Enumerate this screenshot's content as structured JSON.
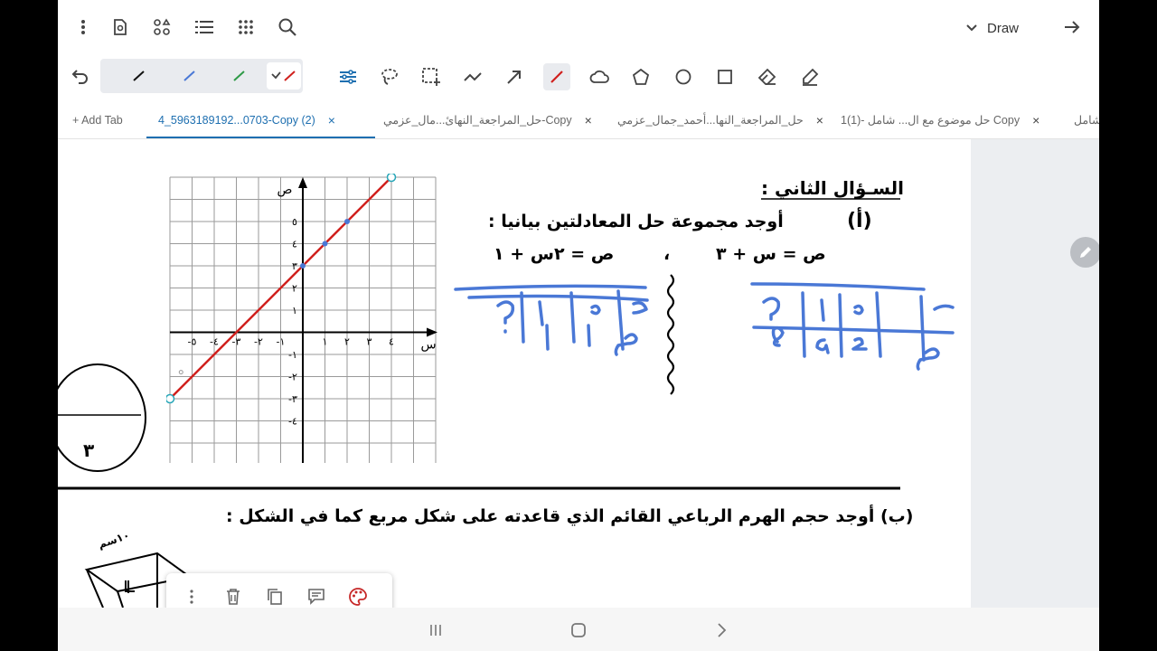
{
  "toolbar": {
    "draw_label": "Draw"
  },
  "tabs": {
    "add_tab": "+ Add Tab",
    "items": [
      {
        "label": "4_5963189192...0703-Copy (2)",
        "close": "×"
      },
      {
        "label": "حل_المراجعة_النهائ...مال_عزمي-Copy",
        "close": "×"
      },
      {
        "label": "حل_المراجعة_النها...أحمد_جمال_عزمي",
        "close": "×"
      },
      {
        "label": "1حل موضوع مع ال... شامل -(1) Copy",
        "close": "×"
      },
      {
        "label": "شامل",
        "close": ""
      }
    ]
  },
  "document": {
    "question_title": "السـؤال الثاني :",
    "part_a_label": "(أ)",
    "part_a_text": "أوجد مجموعة حل المعادلتين بيانيا :",
    "equation_1": "ص = س + ٣",
    "separator": "،",
    "equation_2": "ص = ٢س + ١",
    "part_b_text": "(ب) أوجد حجم الهرم الرباعي القائم الذي قاعدته على شكل مربع كما في الشكل :",
    "circle_label": "٣",
    "pyramid_label": "١٠سم",
    "graph": {
      "y_axis_label": "ص",
      "x_axis_label": "س",
      "x_ticks_positive": [
        "١",
        "٢",
        "٣",
        "٤"
      ],
      "x_ticks_negative": [
        "-١",
        "-٢",
        "-٣",
        "-٤",
        "-٥"
      ],
      "y_ticks_positive": [
        "١",
        "٢",
        "٣",
        "٤",
        "٥"
      ],
      "y_ticks_negative": [
        "-١",
        "-٢",
        "-٣",
        "-٤"
      ]
    },
    "handwriting": {
      "left_table": [
        "٢",
        "١",
        "٠",
        "س",
        "٣",
        "٣",
        "٢",
        "ص"
      ],
      "right_table": [
        "٢",
        "١",
        "٠",
        "س",
        "٥",
        "٤",
        "٣",
        "ص"
      ]
    }
  },
  "colors": {
    "accent": "#1e6fb0",
    "line_red": "#d0201d",
    "ink_blue": "#4a78d6",
    "palette_red": "#c62828"
  }
}
